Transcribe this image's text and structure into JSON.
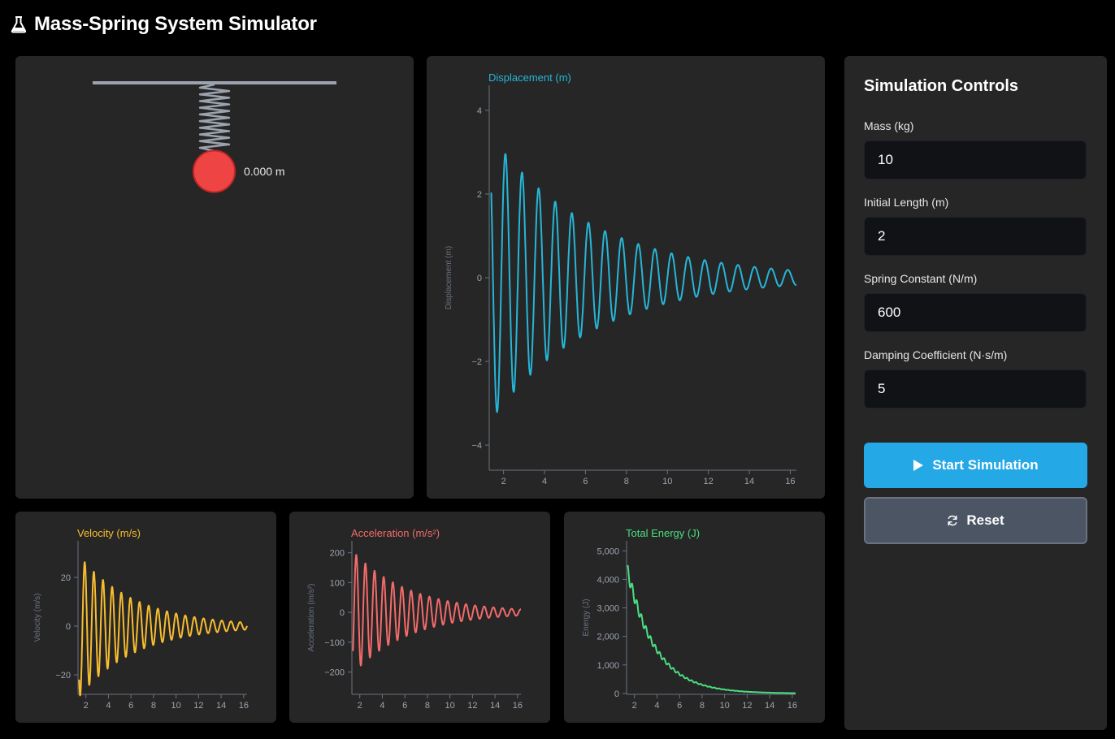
{
  "app": {
    "title": "Mass-Spring System Simulator",
    "icon": "flask-icon"
  },
  "animation": {
    "displacement_readout": "0.000 m"
  },
  "controls": {
    "heading": "Simulation Controls",
    "fields": [
      {
        "label": "Mass (kg)",
        "value": "10"
      },
      {
        "label": "Initial Length (m)",
        "value": "2"
      },
      {
        "label": "Spring Constant (N/m)",
        "value": "600"
      },
      {
        "label": "Damping Coefficient (N·s/m)",
        "value": "5"
      }
    ],
    "start_label": "Start Simulation",
    "start_icon": "play-icon",
    "reset_label": "Reset",
    "reset_icon": "refresh-icon"
  },
  "colors": {
    "displacement": "#26b6d8",
    "velocity": "#f8bd2f",
    "acceleration": "#f36b6b",
    "energy": "#4ade80",
    "mass": "#ef4444",
    "button_primary": "#25a8e6",
    "button_secondary": "#4b5563"
  },
  "chart_data": [
    {
      "type": "line",
      "title": "Displacement (m)",
      "ylabel": "Displacement (m)",
      "xlabel": "",
      "xlim": [
        1.3,
        16.3
      ],
      "ylim": [
        -4.6,
        4.6
      ],
      "xticks": [
        2,
        4,
        6,
        8,
        10,
        12,
        14,
        16
      ],
      "yticks": [
        -4,
        -2,
        0,
        2,
        4
      ],
      "ytick_labels": [
        "−4",
        "−2",
        "0",
        "2",
        "4"
      ],
      "model": {
        "t0": 1.4,
        "t1": 16.3,
        "amplitude": 3.4,
        "decay": 0.2,
        "omega": 7.746,
        "phase": 2.5,
        "offset": 0
      }
    },
    {
      "type": "line",
      "title": "Velocity (m/s)",
      "ylabel": "Velocity (m/s)",
      "xlabel": "",
      "xlim": [
        1.3,
        16.3
      ],
      "ylim": [
        -28,
        35
      ],
      "xticks": [
        2,
        4,
        6,
        8,
        10,
        12,
        14,
        16
      ],
      "yticks": [
        -20,
        0,
        20
      ],
      "ytick_labels": [
        "−20",
        "0",
        "20"
      ],
      "model": {
        "t0": 1.4,
        "t1": 16.3,
        "amplitude": 29,
        "decay": 0.2,
        "omega": 7.746,
        "phase": 4.0,
        "offset": 0
      }
    },
    {
      "type": "line",
      "title": "Acceleration (m/s²)",
      "ylabel": "Acceleration (m/s²)",
      "xlabel": "",
      "xlim": [
        1.3,
        16.3
      ],
      "ylim": [
        -275,
        240
      ],
      "xticks": [
        2,
        4,
        6,
        8,
        10,
        12,
        14,
        16
      ],
      "yticks": [
        -200,
        -100,
        0,
        100,
        200
      ],
      "ytick_labels": [
        "−200",
        "−100",
        "0",
        "100",
        "200"
      ],
      "model": {
        "t0": 1.4,
        "t1": 16.3,
        "amplitude": 205,
        "decay": 0.2,
        "omega": 7.746,
        "phase": 5.6,
        "offset": 0
      }
    },
    {
      "type": "line",
      "title": "Total Energy (J)",
      "ylabel": "Energy (J)",
      "xlabel": "",
      "xlim": [
        1.3,
        16.3
      ],
      "ylim": [
        -30,
        5350
      ],
      "xticks": [
        2,
        4,
        6,
        8,
        10,
        12,
        14,
        16
      ],
      "yticks": [
        0,
        1000,
        2000,
        3000,
        4000,
        5000
      ],
      "ytick_labels": [
        "0",
        "1,000",
        "2,000",
        "3,000",
        "4,000",
        "5,000"
      ],
      "model": {
        "t0": 1.4,
        "t1": 16.3,
        "start": 4500,
        "decay": 0.4,
        "ripple": 0.1,
        "omega": 15.5
      }
    }
  ]
}
